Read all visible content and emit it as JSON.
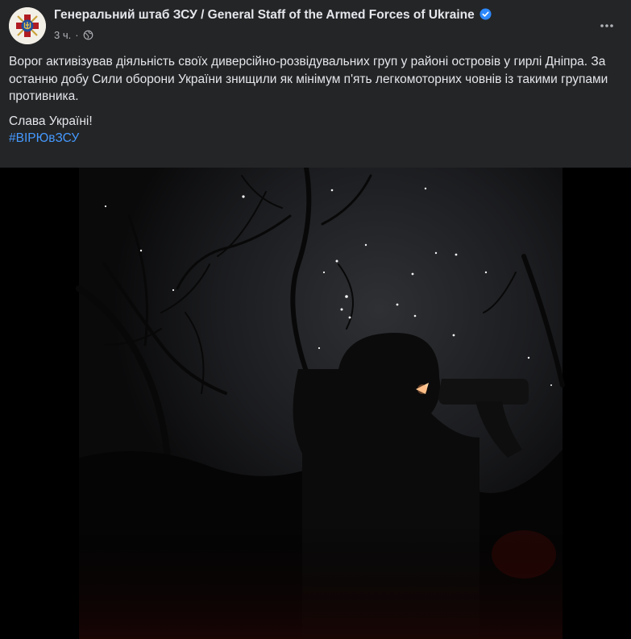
{
  "post": {
    "page_name": "Генеральний штаб ЗСУ / General Staff of the Armed Forces of Ukraine",
    "time": "3 ч.",
    "separator": "·",
    "text_paragraph_1": "Ворог активізував діяльність своїх диверсійно-розвідувальних груп у районі островів у гирлі Дніпра. За останню добу Сили оборони України знищили як мінімум п'ять легкомоторних човнів із такими групами противника.",
    "text_paragraph_2": "Слава Україні!",
    "hashtag": "#ВІРЮвЗСУ"
  },
  "icons": {
    "avatar": "general-staff-emblem",
    "verified": "verified-badge-icon",
    "audience": "globe-icon",
    "options": "more-options-icon"
  },
  "colors": {
    "background": "#242526",
    "text": "#e4e6eb",
    "secondary_text": "#b0b3b8",
    "link": "#4599ff",
    "verified": "#2d88ff"
  }
}
